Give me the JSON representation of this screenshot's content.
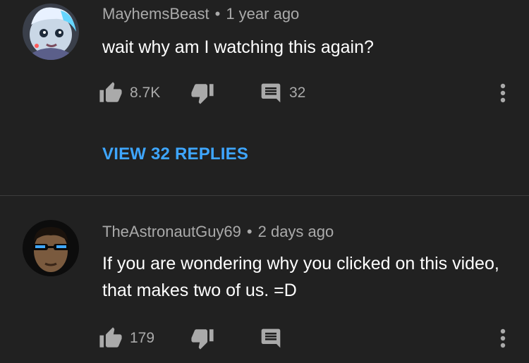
{
  "comments": [
    {
      "author": "MayhemsBeast",
      "separator": "•",
      "time": "1 year ago",
      "text": "wait why am I watching this again?",
      "likes": "8.7K",
      "reply_count": "32",
      "view_replies": "VIEW 32 REPLIES"
    },
    {
      "author": "TheAstronautGuy69",
      "separator": "•",
      "time": "2 days ago",
      "text": "If you are wondering why you clicked on this video, that makes two of us. =D",
      "likes": "179"
    }
  ],
  "icons": {
    "like": "thumbs-up-icon",
    "dislike": "thumbs-down-icon",
    "reply": "comment-icon",
    "more": "more-vertical-icon"
  },
  "colors": {
    "background": "#212121",
    "secondary_text": "#aaaaaa",
    "link": "#3ea6ff"
  }
}
